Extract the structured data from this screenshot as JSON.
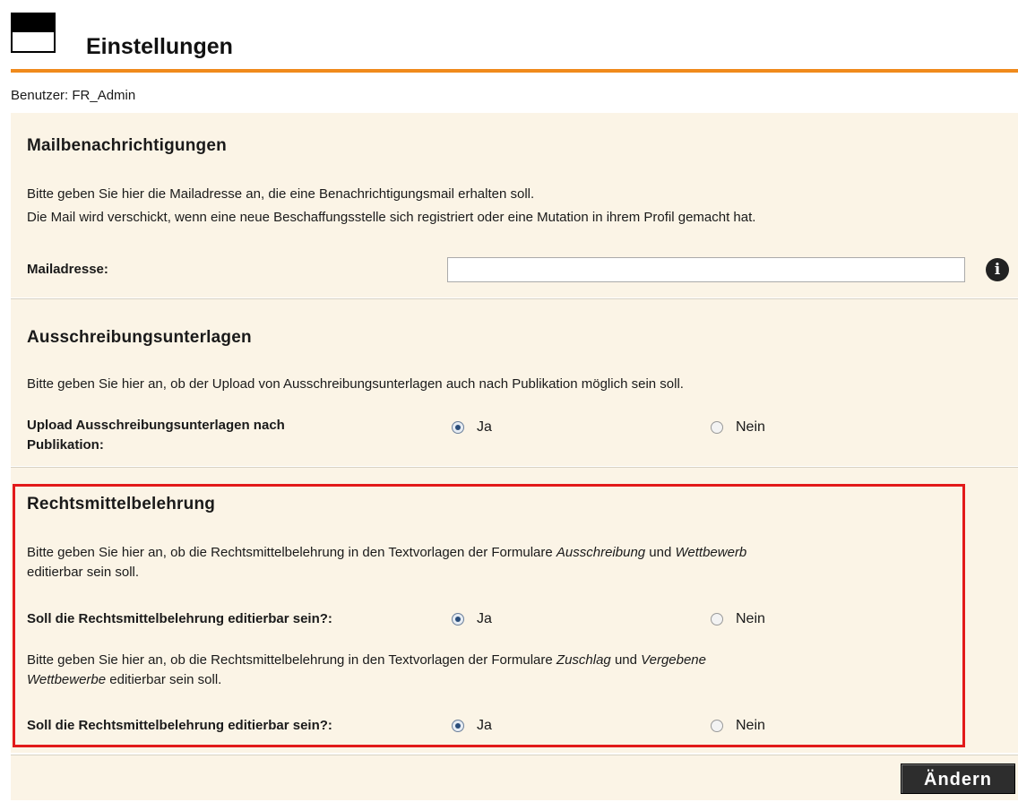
{
  "header": {
    "title": "Einstellungen",
    "user": "Benutzer: FR_Admin"
  },
  "mail": {
    "heading": "Mailbenachrichtigungen",
    "desc1": "Bitte geben Sie hier die Mailadresse an, die eine Benachrichtigungsmail erhalten soll.",
    "desc2": "Die Mail wird verschickt, wenn eine neue Beschaffungsstelle sich registriert oder eine Mutation in ihrem Profil gemacht hat.",
    "label": "Mailadresse:",
    "value": "",
    "info_glyph": "i"
  },
  "upload": {
    "heading": "Ausschreibungsunterlagen",
    "desc": "Bitte geben Sie hier an, ob der Upload von Ausschreibungsunterlagen auch nach Publikation möglich sein soll.",
    "label_line1": "Upload Ausschreibungsunterlagen nach",
    "label_line2": "Publikation:",
    "selected": "Ja"
  },
  "legal": {
    "heading": "Rechtsmittelbelehrung",
    "desc1_a": "Bitte geben Sie hier an, ob die Rechtsmittelbelehrung in den Textvorlagen der Formulare ",
    "desc1_i1": "Ausschreibung",
    "desc1_b": " und ",
    "desc1_i2": "Wettbewerb",
    "desc1_c": "editierbar sein soll.",
    "q1": "Soll die Rechtsmittelbelehrung editierbar sein?:",
    "q1_selected": "Ja",
    "desc2_a": "Bitte geben Sie hier an, ob die Rechtsmittelbelehrung in den Textvorlagen der Formulare ",
    "desc2_i1": "Zuschlag",
    "desc2_b": " und ",
    "desc2_i2": "Vergebene",
    "desc2_i3": "Wettbewerbe",
    "desc2_c": " editierbar sein soll.",
    "q2": "Soll die Rechtsmittelbelehrung editierbar sein?:",
    "q2_selected": "Ja"
  },
  "options": {
    "yes": "Ja",
    "no": "Nein"
  },
  "actions": {
    "submit": "Ändern"
  },
  "colors": {
    "accent_rule": "#f08a1c",
    "panel": "#fbf4e6",
    "highlight_border": "#e21a1a"
  }
}
